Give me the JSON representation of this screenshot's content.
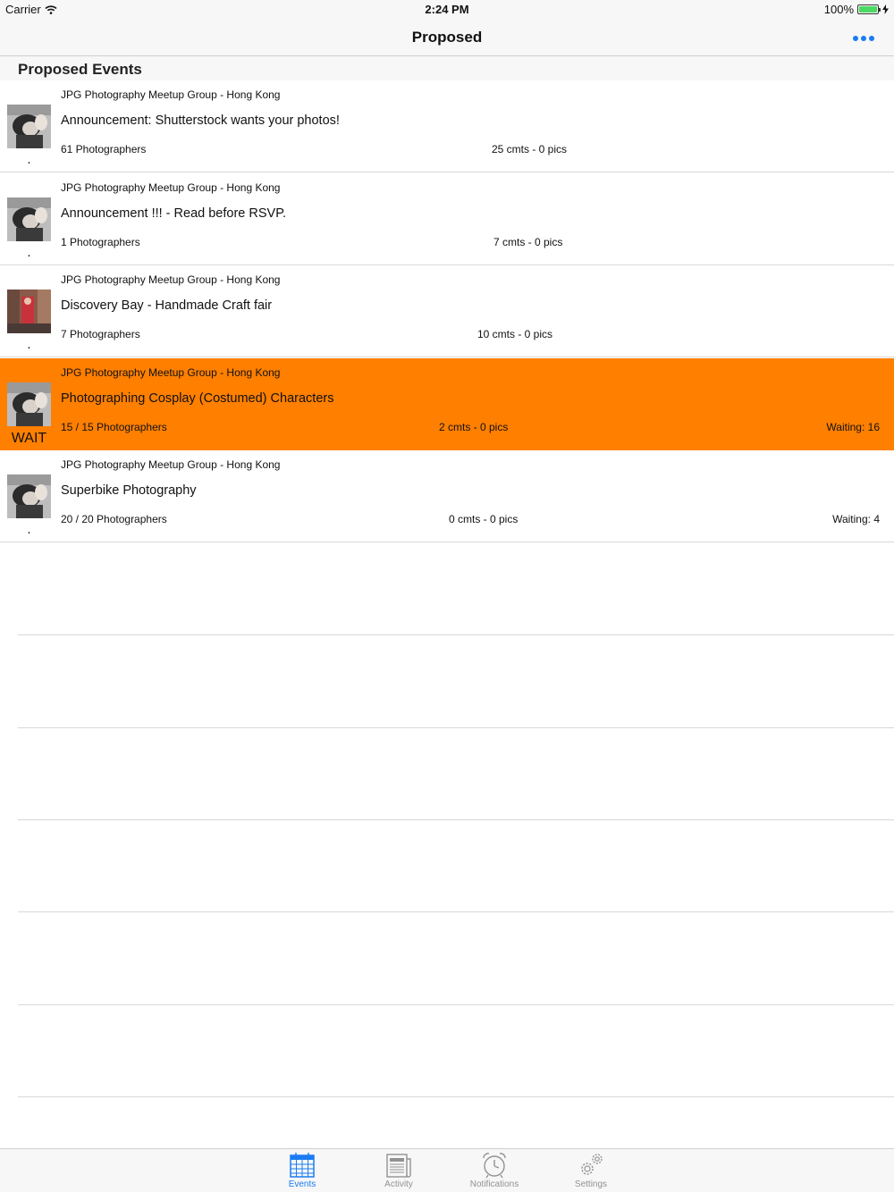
{
  "status_bar": {
    "carrier": "Carrier",
    "time": "2:24 PM",
    "battery": "100%"
  },
  "nav": {
    "title": "Proposed",
    "more_icon": "more-dots-icon"
  },
  "section": {
    "title": "Proposed Events"
  },
  "events": [
    {
      "group": "JPG Photography Meetup Group - Hong Kong",
      "title": "Announcement: Shutterstock wants your photos!",
      "rsvp": "61 Photographers",
      "counts": "25 cmts - 0 pics",
      "waiting": "",
      "status": ".",
      "thumb": "portrait"
    },
    {
      "group": "JPG Photography Meetup Group - Hong Kong",
      "title": "Announcement !!! - Read before RSVP.",
      "rsvp": "1 Photographers",
      "counts": "7 cmts - 0 pics",
      "waiting": "",
      "status": ".",
      "thumb": "portrait"
    },
    {
      "group": "JPG Photography Meetup Group - Hong Kong",
      "title": "Discovery Bay - Handmade Craft fair",
      "rsvp": "7 Photographers",
      "counts": "10 cmts - 0 pics",
      "waiting": "",
      "status": ".",
      "thumb": "craft"
    },
    {
      "group": "JPG Photography Meetup Group - Hong Kong",
      "title": "Photographing Cosplay (Costumed) Characters",
      "rsvp": "15 / 15 Photographers",
      "counts": "2 cmts - 0 pics",
      "waiting": "Waiting: 16",
      "status": "WAIT",
      "thumb": "portrait"
    },
    {
      "group": "JPG Photography Meetup Group - Hong Kong",
      "title": "Superbike Photography",
      "rsvp": "20 / 20 Photographers",
      "counts": "0 cmts - 0 pics",
      "waiting": "Waiting: 4",
      "status": ".",
      "thumb": "portrait"
    }
  ],
  "tabs": [
    {
      "label": "Events",
      "icon": "calendar-icon",
      "active": true
    },
    {
      "label": "Activity",
      "icon": "newspaper-icon",
      "active": false
    },
    {
      "label": "Notifications",
      "icon": "alarm-clock-icon",
      "active": false
    },
    {
      "label": "Settings",
      "icon": "gears-icon",
      "active": false
    }
  ],
  "colors": {
    "accent": "#1a7cf2",
    "highlight_row": "#ff7f00",
    "separator": "#d8d8d8"
  }
}
